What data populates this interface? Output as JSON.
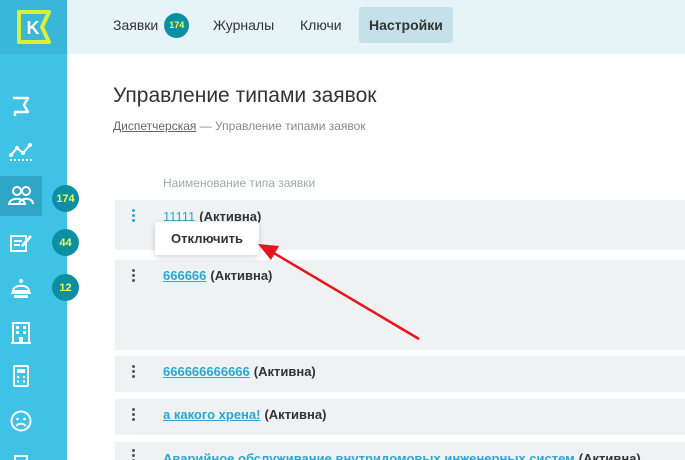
{
  "nav": {
    "tabs": [
      {
        "label": "Заявки",
        "badge": "174"
      },
      {
        "label": "Журналы"
      },
      {
        "label": "Ключи"
      },
      {
        "label": "Настройки"
      }
    ]
  },
  "sidebar": {
    "logo_letter": "K",
    "badges": [
      "174",
      "44",
      "12"
    ],
    "icons": [
      "flag-icon",
      "analytics-icon",
      "users-icon",
      "edit-icon",
      "bell-icon",
      "building-icon",
      "calculator-icon",
      "sad-face-icon",
      "document-icon"
    ]
  },
  "page": {
    "title": "Управление типами заявок",
    "breadcrumb_link": "Диспетчерская",
    "breadcrumb_rest": " — Управление типами заявок",
    "column_header": "Наименование типа заявки"
  },
  "rows": [
    {
      "name": "11111",
      "status": "(Активна)"
    },
    {
      "name": "666666",
      "status": "(Активна)"
    },
    {
      "name": "666666666666",
      "status": "(Активна)"
    },
    {
      "name": "а какого хрена!",
      "status": "(Активна)"
    },
    {
      "name": "Аварийное обслуживание внутридомовых инженерных систем",
      "status": "(Активна)"
    }
  ],
  "popup": {
    "label": "Отключить"
  },
  "colors": {
    "sidebar": "#3ec3e6",
    "accent": "#2aa7d4",
    "badge_bg": "#0d8fa3",
    "badge_text": "#f1ff57",
    "arrow": "#e8141b"
  }
}
